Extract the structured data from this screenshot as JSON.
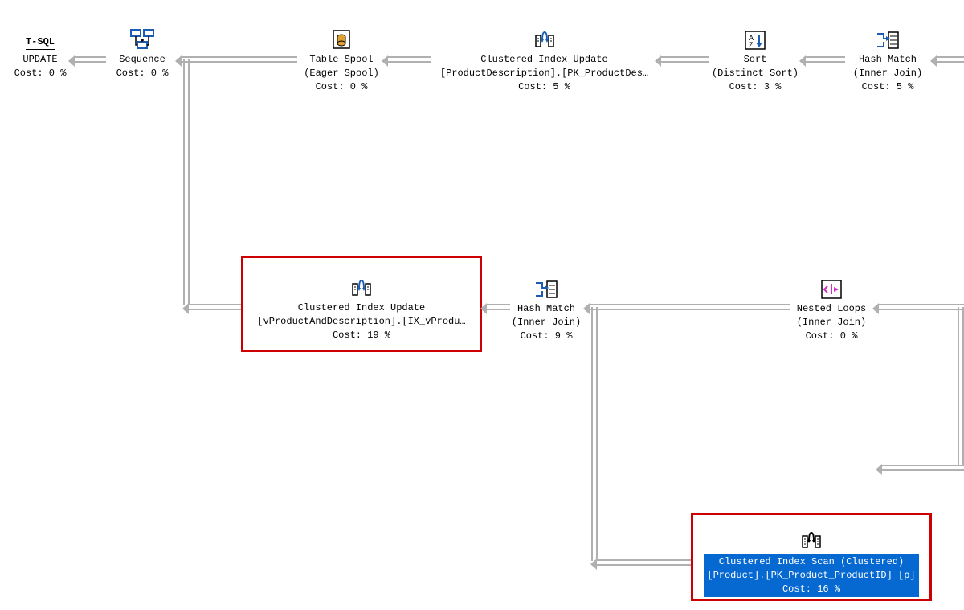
{
  "nodes": {
    "update": {
      "line1": "UPDATE",
      "line2": "",
      "cost": "Cost: 0 %",
      "icon_label": "T-SQL"
    },
    "sequence": {
      "line1": "Sequence",
      "line2": "",
      "cost": "Cost: 0 %"
    },
    "tablespool": {
      "line1": "Table Spool",
      "line2": "(Eager Spool)",
      "cost": "Cost: 0 %"
    },
    "ciu1": {
      "line1": "Clustered Index Update",
      "line2": "[ProductDescription].[PK_ProductDes…",
      "cost": "Cost: 5 %"
    },
    "sort": {
      "line1": "Sort",
      "line2": "(Distinct Sort)",
      "cost": "Cost: 3 %"
    },
    "hash1": {
      "line1": "Hash Match",
      "line2": "(Inner Join)",
      "cost": "Cost: 5 %"
    },
    "ciu2": {
      "line1": "Clustered Index Update",
      "line2": "[vProductAndDescription].[IX_vProdu…",
      "cost": "Cost: 19 %"
    },
    "hash2": {
      "line1": "Hash Match",
      "line2": "(Inner Join)",
      "cost": "Cost: 9 %"
    },
    "nested": {
      "line1": "Nested Loops",
      "line2": "(Inner Join)",
      "cost": "Cost: 0 %"
    },
    "ciscan": {
      "line1": "Clustered Index Scan (Clustered)",
      "line2": "[Product].[PK_Product_ProductID] [p]",
      "cost": "Cost: 16 %"
    }
  }
}
